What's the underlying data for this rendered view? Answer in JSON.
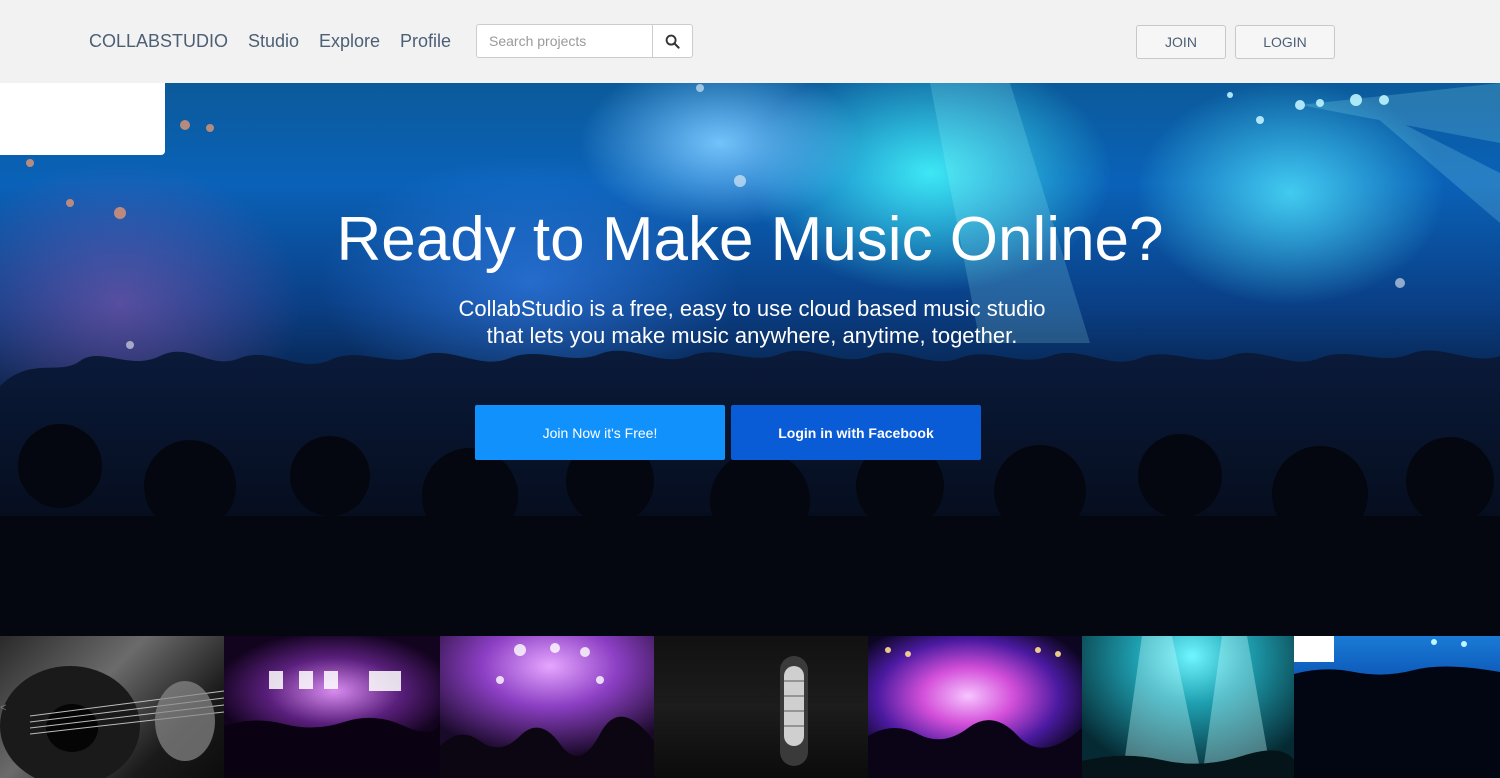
{
  "nav": {
    "brand": "COLLABSTUDIO",
    "links": [
      "Studio",
      "Explore",
      "Profile"
    ],
    "search_placeholder": "Search projects",
    "search_icon": "search-icon",
    "join_label": "JOIN",
    "login_label": "LOGIN"
  },
  "hero": {
    "title": "Ready to Make Music Online?",
    "subtitle": "CollabStudio is a free, easy to use cloud based music studio that lets you make music anywhere, anytime, together.",
    "join_cta": "Join Now it's Free!",
    "facebook_cta": "Login in with Facebook"
  },
  "thumbnails": [
    {
      "name": "thumb-guitar"
    },
    {
      "name": "thumb-stage-lights"
    },
    {
      "name": "thumb-purple-crowd"
    },
    {
      "name": "thumb-microphone"
    },
    {
      "name": "thumb-pink-concert"
    },
    {
      "name": "thumb-teal-stage"
    },
    {
      "name": "thumb-blue-crowd"
    }
  ],
  "colors": {
    "nav_bg": "#f2f2f2",
    "nav_text": "#4c5f75",
    "join_cta_bg": "#1191fb",
    "facebook_cta_bg": "#0a5bd6"
  }
}
